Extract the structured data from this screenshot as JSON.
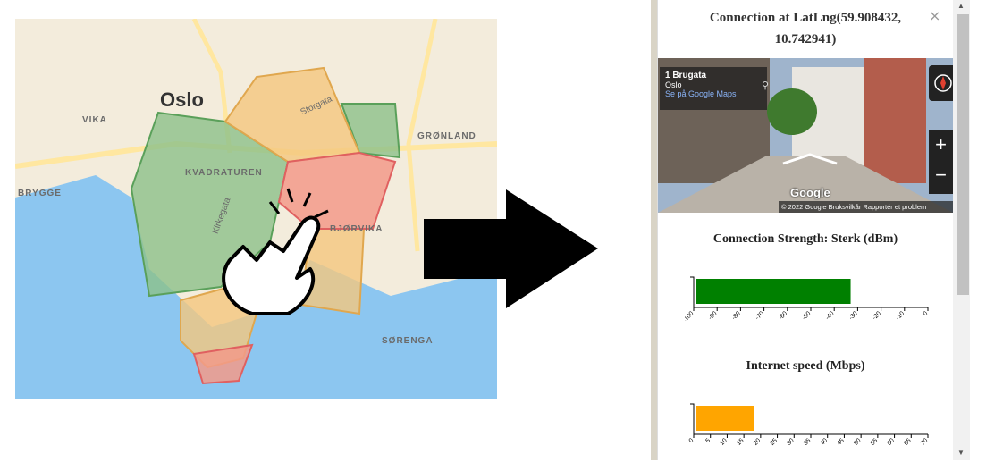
{
  "map": {
    "city_label": "Oslo",
    "labels": [
      {
        "text": "VIKA"
      },
      {
        "text": "KVADRATUREN"
      },
      {
        "text": "GRØNLAND"
      },
      {
        "text": "BRYGGE"
      },
      {
        "text": "BJØRVIKA"
      },
      {
        "text": "SØRENGA"
      },
      {
        "text": "Storgata"
      },
      {
        "text": "Kirkegata"
      }
    ]
  },
  "popup": {
    "title_line1": "Connection at LatLng(59.908432,",
    "title_line2": "10.742941)",
    "close_glyph": "×",
    "streetview": {
      "address": "1 Brugata",
      "city": "Oslo",
      "maps_link": "Se på Google Maps",
      "logo": "Google",
      "footer": "© 2022 Google   Bruksvilkår   Rapportér et problem",
      "zoom_in": "+",
      "zoom_out": "−"
    }
  },
  "chart_data": [
    {
      "type": "bar",
      "title": "Connection Strength: Sterk (dBm)",
      "values": [
        -33
      ],
      "xlim": [
        -100,
        0
      ],
      "ticks": [
        -100,
        -90,
        -80,
        -70,
        -60,
        -50,
        -40,
        -30,
        -20,
        -10,
        0
      ],
      "color": "#008000"
    },
    {
      "type": "bar",
      "title": "Internet speed (Mbps)",
      "values": [
        18
      ],
      "xlim": [
        0,
        70
      ],
      "ticks": [
        0,
        5,
        10,
        15,
        20,
        25,
        30,
        35,
        40,
        45,
        50,
        55,
        60,
        65,
        70
      ],
      "color": "#ffa500"
    }
  ]
}
